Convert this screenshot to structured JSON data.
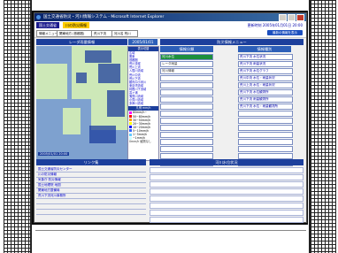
{
  "browser": {
    "title": "国土交通省防災・河川情報システム - Microsoft Internet Explorer"
  },
  "header": {
    "logo_text": "国土交通省",
    "section_text": "川の防災情報",
    "updated_text": "更新時刻 2005年01月01日 20:00",
    "refresh_label": "最新の情報を表示"
  },
  "toolbar": {
    "menu_select": "情報メニュー",
    "area_select": "関東地方 (首都圏)",
    "office_select": "荒川下流",
    "river_select": "河川名 荒川"
  },
  "radar": {
    "title": "レーダ雨量情報",
    "time_title": "2005/01/01 20:00",
    "map_timestamp": "2005/01/01 20:00",
    "legend_header": "表示切替",
    "legend_items": [
      "広域",
      "関東",
      "首都圏",
      "荒川流域",
      "荒川上流",
      "入間川流域",
      "荒川中流",
      "荒川下流",
      "都内中小河川",
      "東京湾流域",
      "利根川下流域",
      "霞ヶ浦",
      "鬼怒川流域",
      "小貝川流域",
      "多摩川流域"
    ],
    "scale_header": "凡例 mm/h",
    "scale": [
      {
        "label": "80mm/h~",
        "color": "#ff00ff"
      },
      {
        "label": "50~80mm/h",
        "color": "#ff0000"
      },
      {
        "label": "30~50mm/h",
        "color": "#ff9900"
      },
      {
        "label": "20~30mm/h",
        "color": "#ffff00"
      },
      {
        "label": "10~20mm/h",
        "color": "#0000ff"
      },
      {
        "label": "5~10mm/h",
        "color": "#3366ff"
      },
      {
        "label": "1~5mm/h",
        "color": "#66ccff"
      },
      {
        "label": "~1mm/h",
        "color": "#ccffff"
      }
    ],
    "scale_footer": "0mm/h 観測なし"
  },
  "info_select": {
    "title": "防災情報メニュー",
    "col1_head": "情報分類",
    "col2_head": "情報種別",
    "categories": [
      "河川水位",
      "レーダ雨量",
      "河川情報"
    ],
    "types": [
      "荒川下流 水位状況",
      "荒川下流 雨量状況",
      "荒川下流 水位グラフ",
      "荒川中流 水位・雨量状況",
      "荒川上流 水位・雨量状況",
      "荒川下流 水位観測所",
      "荒川下流 雨量観測所",
      "荒川下流 水位・雨量観測所"
    ]
  },
  "links": {
    "title": "リンク集",
    "items": [
      "国土交通省防災センター",
      "川の防災情報",
      "気象庁 防災情報",
      "国土地理院 地図",
      "関東地方整備局",
      "荒川下流河川事務所",
      "",
      "",
      ""
    ]
  },
  "water": {
    "title": "河川水位状況"
  }
}
